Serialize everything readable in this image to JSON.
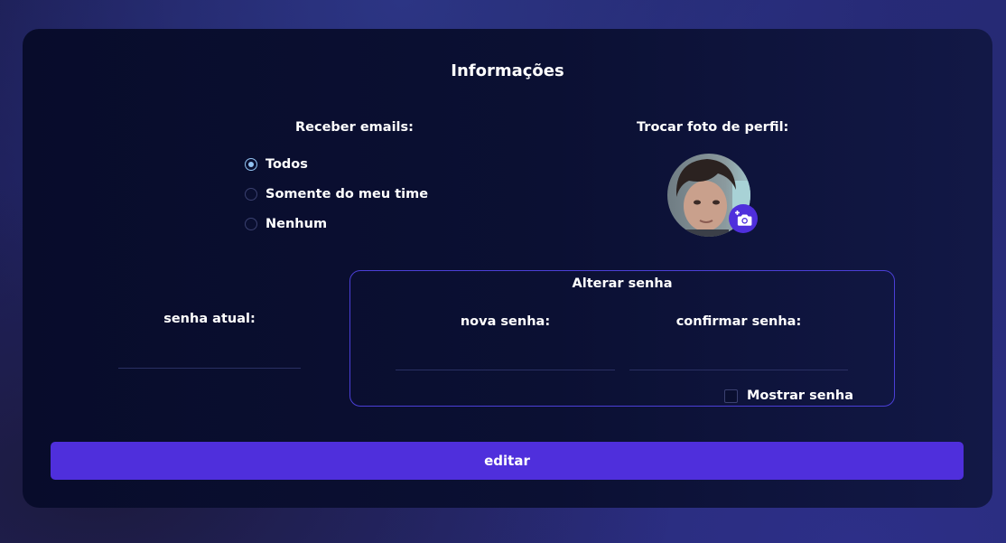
{
  "page": {
    "title": "Informações"
  },
  "emails": {
    "label": "Receber emails:",
    "options": [
      {
        "label": "Todos",
        "checked": true
      },
      {
        "label": "Somente do meu time",
        "checked": false
      },
      {
        "label": "Nenhum",
        "checked": false
      }
    ]
  },
  "profile_photo": {
    "label": "Trocar foto de perfil:",
    "camera_icon": "add-a-photo-icon"
  },
  "current_password": {
    "label": "senha atual:",
    "value": ""
  },
  "change_password": {
    "title": "Alterar senha",
    "new_label": "nova senha:",
    "new_value": "",
    "confirm_label": "confirmar senha:",
    "confirm_value": "",
    "show_password_label": "Mostrar senha",
    "show_password_checked": false
  },
  "actions": {
    "edit_label": "editar"
  },
  "colors": {
    "accent": "#4f2fdc",
    "radio_checked": "#93c4f2",
    "box_border": "#4b3fd6",
    "card_bg": "#0a0f30"
  }
}
